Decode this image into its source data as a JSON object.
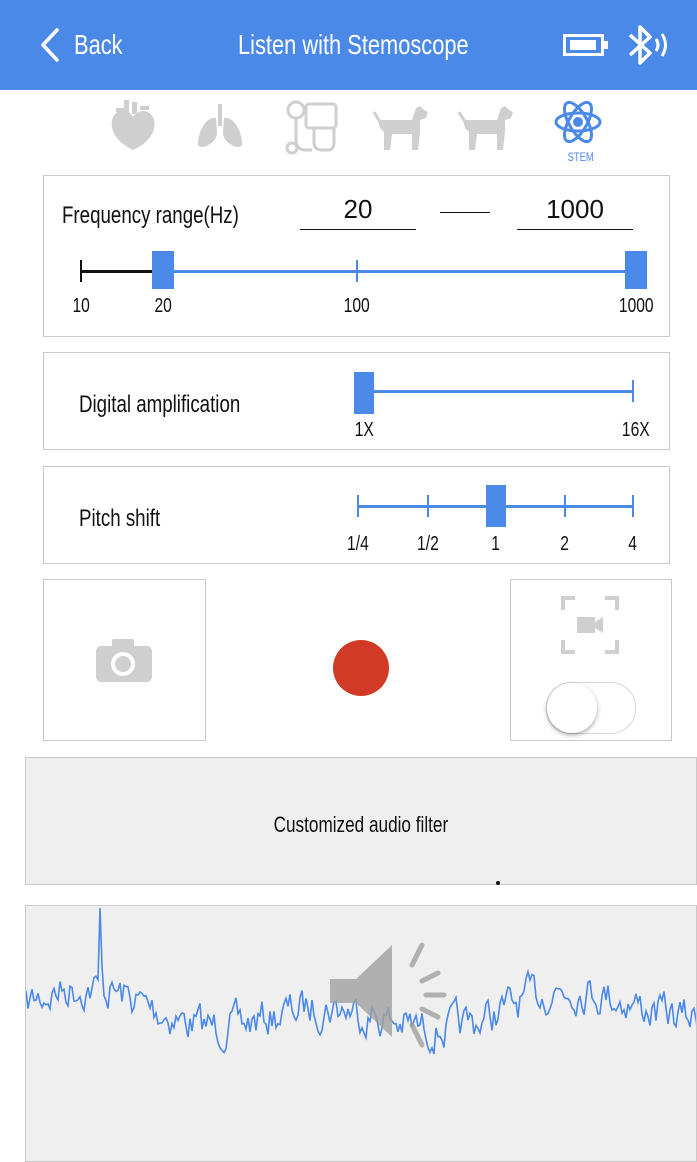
{
  "header": {
    "back_label": "Back",
    "title": "Listen with Stemoscope",
    "bg_color": "#4a89e8"
  },
  "modes": {
    "items": [
      "heart-icon",
      "lungs-icon",
      "stethoscope-icon",
      "dog-icon",
      "dog-icon",
      "atom-icon"
    ],
    "active_label": "STEM",
    "active_color": "#4a89e8",
    "inactive_color": "#cfcfcf"
  },
  "frequency": {
    "label": "Frequency range(Hz)",
    "min_value": "20",
    "max_value": "1000",
    "ticks": [
      "10",
      "20",
      "100",
      "1000"
    ],
    "range": [
      20,
      1000
    ]
  },
  "amplification": {
    "label": "Digital amplification",
    "ticks": [
      "1X",
      "16X"
    ],
    "value": "1X"
  },
  "pitch": {
    "label": "Pitch shift",
    "ticks": [
      "1/4",
      "1/2",
      "1",
      "2",
      "4"
    ],
    "value": "1"
  },
  "capture": {
    "photo_icon": "camera-icon",
    "video_icon": "video-focus-icon",
    "record_color": "#d03a26",
    "video_toggle_on": false
  },
  "filter": {
    "label": "Customized audio filter"
  },
  "waveform": {
    "line_color": "#4a89e8",
    "overlay_icon": "speaker-volume-icon"
  }
}
